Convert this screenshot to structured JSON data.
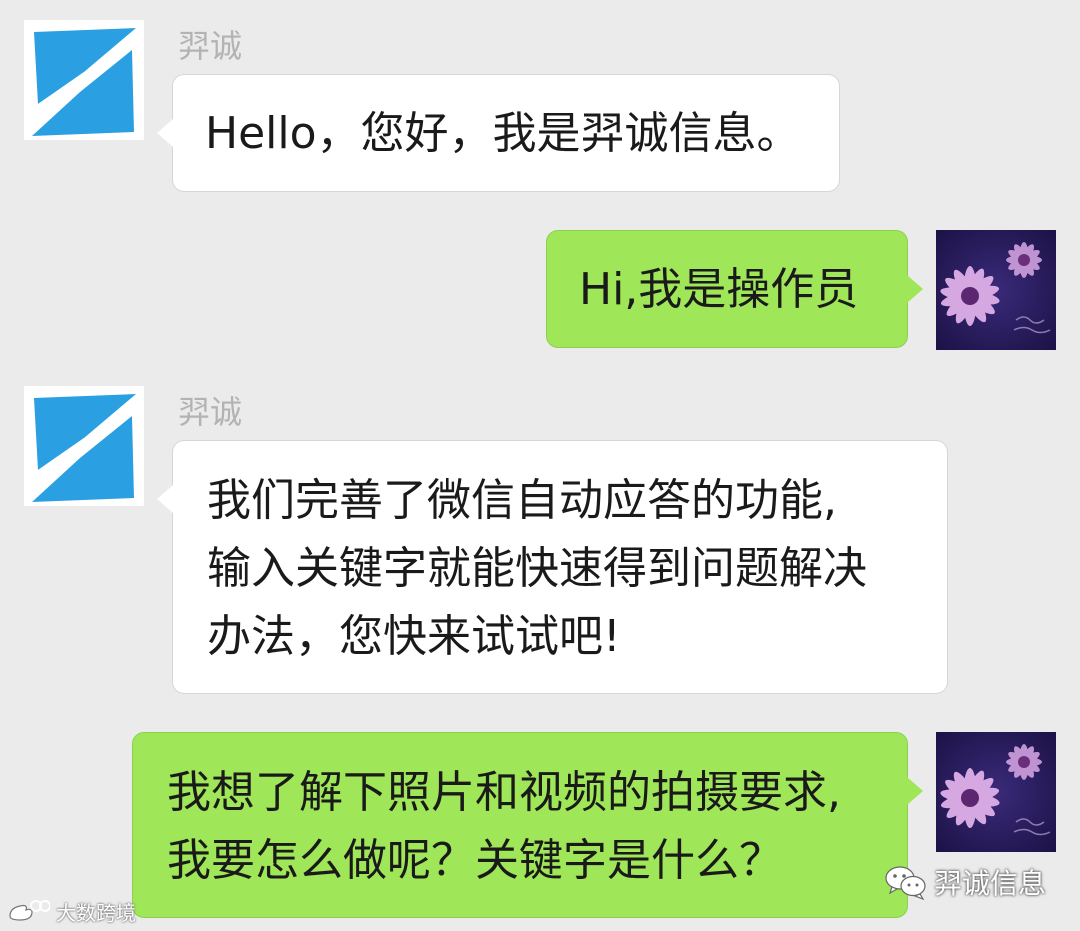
{
  "messages": [
    {
      "sender": "羿诚",
      "direction": "incoming",
      "lines": [
        "Hello，您好，我是羿诚信息。"
      ]
    },
    {
      "direction": "outgoing",
      "lines": [
        "Hi,我是操作员"
      ]
    },
    {
      "sender": "羿诚",
      "direction": "incoming",
      "lines": [
        "我们完善了微信自动应答的功能,",
        "输入关键字就能快速得到问题解决",
        "办法，您快来试试吧!"
      ]
    },
    {
      "direction": "outgoing",
      "lines": [
        "我想了解下照片和视频的拍摄要求,",
        "我要怎么做呢？关键字是什么？"
      ]
    }
  ],
  "watermarks": {
    "left_text": "大数跨境",
    "right_text": "羿诚信息"
  },
  "colors": {
    "background": "#ebebeb",
    "incoming_bubble": "#ffffff",
    "outgoing_bubble": "#9fe658",
    "brand_blue": "#2a9fe0",
    "sender_name": "#b3b3b3"
  },
  "icons": {
    "brand_avatar": "brand-logo-icon",
    "user_avatar": "purple-flower-avatar",
    "wechat": "wechat-icon",
    "weibo": "weibo-icon"
  }
}
